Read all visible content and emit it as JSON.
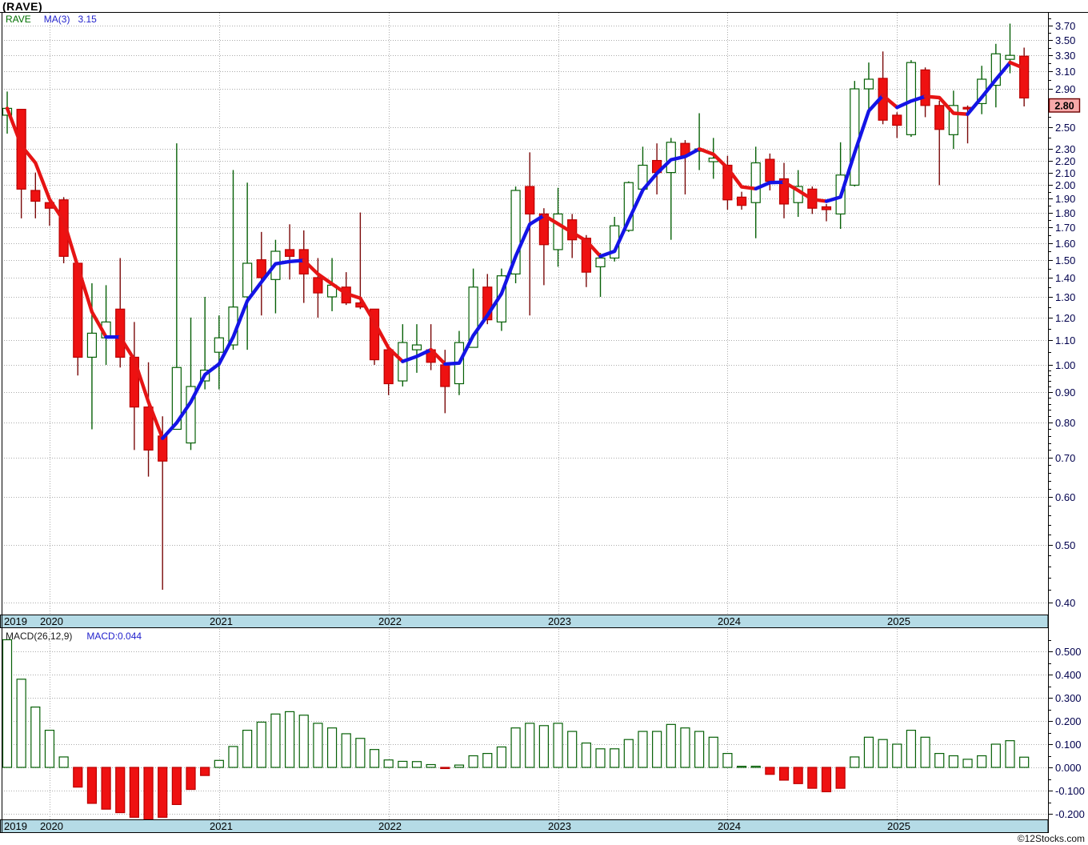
{
  "title": "(RAVE)",
  "watermark": "©12Stocks.com",
  "price_panel": {
    "legend": {
      "symbol": "RAVE",
      "ma_label": "MA(3)",
      "ma_value": "3.15"
    },
    "y_axis_labels": [
      "3.70",
      "3.50",
      "3.30",
      "3.10",
      "2.90",
      "2.50",
      "2.30",
      "2.20",
      "2.10",
      "2.00",
      "1.90",
      "1.80",
      "1.70",
      "1.60",
      "1.50",
      "1.40",
      "1.30",
      "1.20",
      "1.10",
      "1.00",
      "0.90",
      "0.80",
      "0.70",
      "0.60",
      "0.50",
      "0.40"
    ],
    "last_price_tag": "2.80"
  },
  "macd_panel": {
    "legend_left": "MACD(26,12,9)",
    "legend_right": "MACD:0.044",
    "y_axis_labels": [
      "0.500",
      "0.400",
      "0.300",
      "0.200",
      "0.100",
      "0.000",
      "-0.100",
      "-0.200"
    ]
  },
  "x_axis": {
    "years": [
      "2019",
      "2020",
      "2021",
      "2022",
      "2023",
      "2024",
      "2025"
    ]
  },
  "colors": {
    "up_stroke": "#066006",
    "down_fill": "#ee1111",
    "down_stroke": "#bb0000",
    "down_wick": "#7a0808",
    "ma_up": "#1414e6",
    "ma_down": "#e61414",
    "grid": "#ababab",
    "strip_bg": "#b5dbe6",
    "axis_text": "#00004d",
    "year_text": "#000000",
    "tag_bg": "#f7a9a9",
    "tag_border": "#6b0000",
    "border": "#000000"
  },
  "chart_data": [
    {
      "type": "candlestick",
      "title": "(RAVE)",
      "ma_overlay": {
        "label": "MA(3)",
        "period": 3,
        "last_value": 3.15
      },
      "yscale": "log",
      "ylim": [
        0.4,
        3.7
      ],
      "last_close": 2.8,
      "x_year_labels": [
        "2019",
        "2020",
        "2021",
        "2022",
        "2023",
        "2024",
        "2025"
      ],
      "ohlc": [
        [
          2.62,
          2.87,
          2.44,
          2.69
        ],
        [
          2.68,
          2.68,
          1.76,
          1.97
        ],
        [
          1.96,
          2.1,
          1.76,
          1.88
        ],
        [
          1.87,
          1.91,
          1.71,
          1.83
        ],
        [
          1.89,
          1.91,
          1.48,
          1.52
        ],
        [
          1.48,
          1.48,
          0.96,
          1.03
        ],
        [
          1.03,
          1.37,
          0.78,
          1.13
        ],
        [
          1.11,
          1.36,
          1.0,
          1.18
        ],
        [
          1.24,
          1.51,
          0.99,
          1.03
        ],
        [
          1.03,
          1.18,
          0.72,
          0.85
        ],
        [
          0.85,
          1.01,
          0.65,
          0.72
        ],
        [
          0.76,
          0.82,
          0.42,
          0.69
        ],
        [
          0.78,
          2.35,
          0.78,
          0.99
        ],
        [
          0.74,
          1.2,
          0.72,
          0.92
        ],
        [
          0.94,
          1.3,
          0.91,
          0.98
        ],
        [
          1.05,
          1.21,
          0.91,
          1.11
        ],
        [
          1.08,
          2.12,
          1.06,
          1.25
        ],
        [
          1.3,
          2.02,
          1.06,
          1.48
        ],
        [
          1.5,
          1.67,
          1.21,
          1.4
        ],
        [
          1.39,
          1.62,
          1.22,
          1.55
        ],
        [
          1.56,
          1.72,
          1.39,
          1.52
        ],
        [
          1.56,
          1.68,
          1.27,
          1.42
        ],
        [
          1.4,
          1.51,
          1.2,
          1.32
        ],
        [
          1.3,
          1.51,
          1.23,
          1.36
        ],
        [
          1.35,
          1.43,
          1.26,
          1.27
        ],
        [
          1.27,
          1.8,
          1.24,
          1.25
        ],
        [
          1.24,
          1.24,
          1.0,
          1.02
        ],
        [
          1.06,
          1.08,
          0.89,
          0.93
        ],
        [
          0.94,
          1.17,
          0.92,
          1.09
        ],
        [
          1.06,
          1.17,
          0.97,
          1.08
        ],
        [
          1.06,
          1.17,
          0.98,
          1.01
        ],
        [
          1.0,
          1.06,
          0.83,
          0.92
        ],
        [
          0.93,
          1.14,
          0.89,
          1.09
        ],
        [
          1.07,
          1.45,
          1.07,
          1.35
        ],
        [
          1.35,
          1.42,
          1.17,
          1.19
        ],
        [
          1.18,
          1.45,
          1.14,
          1.41
        ],
        [
          1.42,
          1.99,
          1.37,
          1.96
        ],
        [
          1.99,
          2.27,
          1.21,
          1.79
        ],
        [
          1.79,
          1.83,
          1.36,
          1.59
        ],
        [
          1.56,
          1.98,
          1.46,
          1.79
        ],
        [
          1.75,
          1.79,
          1.51,
          1.62
        ],
        [
          1.63,
          1.65,
          1.35,
          1.43
        ],
        [
          1.46,
          1.54,
          1.3,
          1.51
        ],
        [
          1.51,
          1.77,
          1.49,
          1.71
        ],
        [
          1.68,
          2.03,
          1.67,
          2.02
        ],
        [
          1.97,
          2.32,
          1.94,
          2.16
        ],
        [
          2.2,
          2.35,
          1.93,
          2.1
        ],
        [
          2.1,
          2.4,
          1.62,
          2.36
        ],
        [
          2.35,
          2.38,
          1.93,
          2.24
        ],
        [
          2.28,
          2.64,
          2.12,
          2.3
        ],
        [
          2.19,
          2.4,
          2.05,
          2.22
        ],
        [
          2.16,
          2.24,
          1.82,
          1.89
        ],
        [
          1.91,
          1.95,
          1.82,
          1.85
        ],
        [
          1.87,
          2.32,
          1.63,
          2.18
        ],
        [
          2.21,
          2.26,
          1.96,
          2.03
        ],
        [
          2.05,
          2.18,
          1.76,
          1.86
        ],
        [
          1.87,
          2.12,
          1.77,
          1.99
        ],
        [
          1.97,
          1.99,
          1.79,
          1.83
        ],
        [
          1.84,
          1.86,
          1.74,
          1.82
        ],
        [
          1.79,
          2.36,
          1.69,
          2.08
        ],
        [
          2.0,
          2.99,
          1.99,
          2.9
        ],
        [
          2.9,
          3.21,
          2.68,
          3.01
        ],
        [
          3.02,
          3.35,
          2.53,
          2.57
        ],
        [
          2.62,
          2.65,
          2.4,
          2.52
        ],
        [
          2.43,
          3.24,
          2.41,
          3.21
        ],
        [
          3.12,
          3.15,
          2.6,
          2.72
        ],
        [
          2.72,
          2.77,
          2.0,
          2.48
        ],
        [
          2.43,
          2.88,
          2.3,
          2.72
        ],
        [
          2.7,
          2.72,
          2.35,
          2.69
        ],
        [
          2.74,
          3.17,
          2.63,
          3.01
        ],
        [
          2.94,
          3.45,
          2.7,
          3.32
        ],
        [
          3.25,
          3.73,
          3.08,
          3.3
        ],
        [
          3.29,
          3.4,
          2.71,
          2.8
        ]
      ]
    },
    {
      "type": "bar",
      "title": "MACD(26,12,9)",
      "last_value": 0.044,
      "ylim": [
        -0.2,
        0.55
      ],
      "values": [
        0.55,
        0.38,
        0.26,
        0.16,
        0.045,
        -0.085,
        -0.155,
        -0.18,
        -0.195,
        -0.215,
        -0.225,
        -0.215,
        -0.16,
        -0.095,
        -0.035,
        0.03,
        0.09,
        0.16,
        0.195,
        0.23,
        0.24,
        0.225,
        0.19,
        0.17,
        0.145,
        0.125,
        0.077,
        0.032,
        0.026,
        0.025,
        0.012,
        -0.005,
        0.01,
        0.05,
        0.06,
        0.088,
        0.17,
        0.19,
        0.18,
        0.19,
        0.155,
        0.105,
        0.08,
        0.08,
        0.12,
        0.155,
        0.155,
        0.185,
        0.17,
        0.155,
        0.13,
        0.06,
        0.0,
        0.005,
        -0.03,
        -0.055,
        -0.07,
        -0.09,
        -0.105,
        -0.09,
        0.045,
        0.13,
        0.12,
        0.1,
        0.16,
        0.13,
        0.06,
        0.05,
        0.035,
        0.05,
        0.1,
        0.115,
        0.044
      ]
    }
  ]
}
